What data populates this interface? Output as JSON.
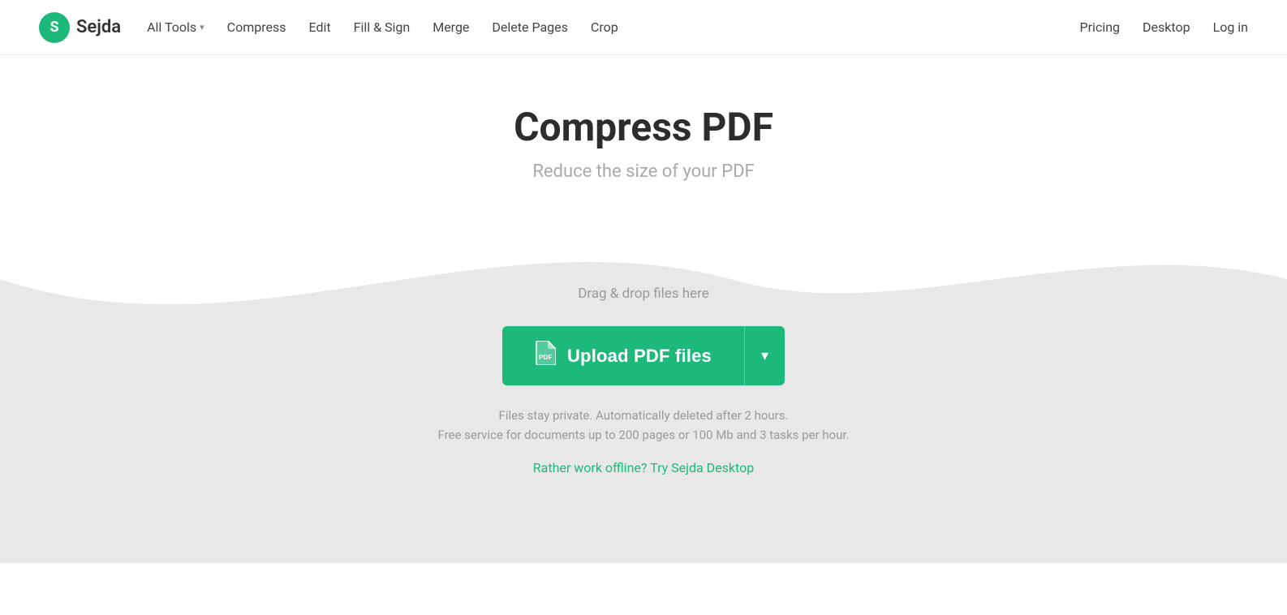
{
  "logo": {
    "letter": "S",
    "name": "Sejda"
  },
  "nav": {
    "all_tools_label": "All Tools",
    "items": [
      {
        "label": "Compress",
        "id": "compress"
      },
      {
        "label": "Edit",
        "id": "edit"
      },
      {
        "label": "Fill & Sign",
        "id": "fill-sign"
      },
      {
        "label": "Merge",
        "id": "merge"
      },
      {
        "label": "Delete Pages",
        "id": "delete-pages"
      },
      {
        "label": "Crop",
        "id": "crop"
      }
    ]
  },
  "nav_right": {
    "items": [
      {
        "label": "Pricing",
        "id": "pricing"
      },
      {
        "label": "Desktop",
        "id": "desktop"
      },
      {
        "label": "Log in",
        "id": "login"
      }
    ]
  },
  "hero": {
    "title": "Compress PDF",
    "subtitle": "Reduce the size of your PDF"
  },
  "upload": {
    "drag_drop_text": "Drag & drop files here",
    "button_label": "Upload PDF files",
    "privacy_text": "Files stay private. Automatically deleted after 2 hours.",
    "limit_text": "Free service for documents up to 200 pages or 100 Mb and 3 tasks per hour.",
    "offline_text": "Rather work offline? Try Sejda Desktop"
  },
  "colors": {
    "green": "#1db97b",
    "wave_bg": "#ebebeb"
  }
}
